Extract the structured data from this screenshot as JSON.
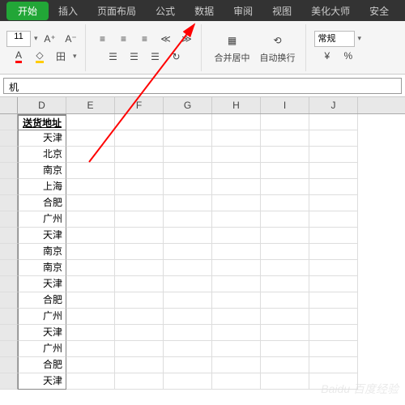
{
  "menu": {
    "tabs": [
      "开始",
      "插入",
      "页面布局",
      "公式",
      "数据",
      "审阅",
      "视图",
      "美化大师",
      "安全"
    ],
    "active_index": 0
  },
  "ribbon": {
    "font_size": "11",
    "inc_font": "A⁺",
    "dec_font": "A⁻",
    "merge_label": "合并居中",
    "wrap_label": "自动换行",
    "number_format": "常规",
    "currency": "¥",
    "percent": "%"
  },
  "formula_bar": {
    "value": "机"
  },
  "columns": [
    "D",
    "E",
    "F",
    "G",
    "H",
    "I",
    "J"
  ],
  "header_cell": "送货地址",
  "data_d": [
    "天津",
    "北京",
    "南京",
    "上海",
    "合肥",
    "广州",
    "天津",
    "南京",
    "南京",
    "天津",
    "合肥",
    "广州",
    "天津",
    "广州",
    "合肥",
    "天津"
  ],
  "watermark": "Baidu 百度经验"
}
